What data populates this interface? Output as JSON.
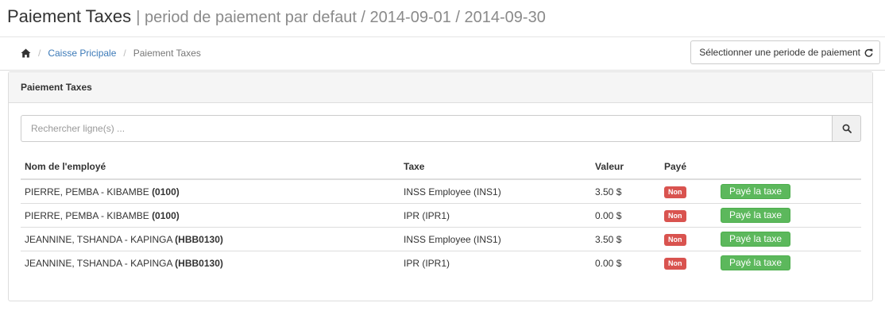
{
  "header": {
    "title": "Paiement Taxes",
    "subtitle": "| period de paiement par defaut / 2014-09-01 / 2014-09-30"
  },
  "breadcrumb": {
    "home_icon": "home-icon",
    "items": [
      "Caisse Pricipale",
      "Paiement Taxes"
    ],
    "separator": "/"
  },
  "toolbar": {
    "period_button_label": "Sélectionner une periode de paiement",
    "period_button_icon": "refresh-icon"
  },
  "panel": {
    "title": "Paiement Taxes",
    "search": {
      "placeholder": "Rechercher ligne(s) ...",
      "value": "",
      "icon": "search-icon"
    },
    "table": {
      "columns": [
        "Nom de l'employé",
        "Taxe",
        "Valeur",
        "Payé",
        ""
      ],
      "rows": [
        {
          "name": "PIERRE, PEMBA - KIBAMBE",
          "code": "(0100)",
          "tax": "INSS Employee (INS1)",
          "value": "3.50 $",
          "paid": "Non",
          "action": "Payé la taxe"
        },
        {
          "name": "PIERRE, PEMBA - KIBAMBE",
          "code": "(0100)",
          "tax": "IPR (IPR1)",
          "value": "0.00 $",
          "paid": "Non",
          "action": "Payé la taxe"
        },
        {
          "name": "JEANNINE, TSHANDA - KAPINGA",
          "code": "(HBB0130)",
          "tax": "INSS Employee (INS1)",
          "value": "3.50 $",
          "paid": "Non",
          "action": "Payé la taxe"
        },
        {
          "name": "JEANNINE, TSHANDA - KAPINGA",
          "code": "(HBB0130)",
          "tax": "IPR (IPR1)",
          "value": "0.00 $",
          "paid": "Non",
          "action": "Payé la taxe"
        }
      ]
    }
  },
  "colors": {
    "link": "#3c7ab8",
    "badge_non": "#d9534f",
    "pay_button": "#5cb85c"
  }
}
